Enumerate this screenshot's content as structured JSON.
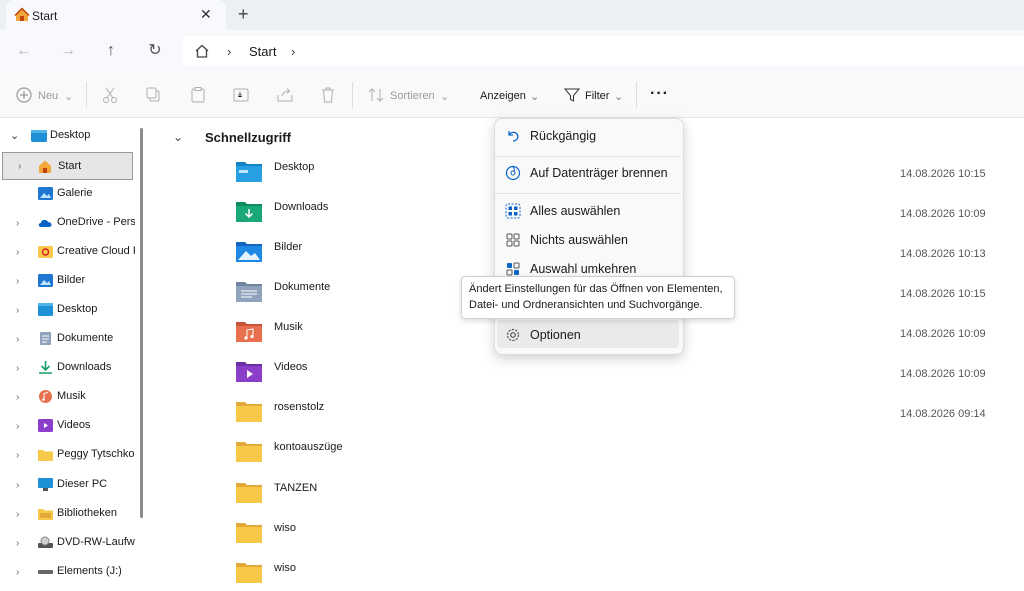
{
  "window": {
    "tab_title": "Start",
    "tab_close": "✕",
    "new_tab": "+"
  },
  "nav": {
    "breadcrumb": "Start",
    "sep1": "›",
    "sep2": "›"
  },
  "toolbar": {
    "new_label": "Neu",
    "sort_label": "Sortieren",
    "view_label": "Anzeigen",
    "filter_label": "Filter",
    "more_label": "···"
  },
  "sidebar": {
    "items": [
      {
        "label": "Desktop"
      },
      {
        "label": "Start"
      },
      {
        "label": "Galerie"
      },
      {
        "label": "OneDrive - Pers"
      },
      {
        "label": "Creative Cloud F"
      },
      {
        "label": "Bilder"
      },
      {
        "label": "Desktop"
      },
      {
        "label": "Dokumente"
      },
      {
        "label": "Downloads"
      },
      {
        "label": "Musik"
      },
      {
        "label": "Videos"
      },
      {
        "label": "Peggy Tytschko"
      },
      {
        "label": "Dieser PC"
      },
      {
        "label": "Bibliotheken"
      },
      {
        "label": "DVD-RW-Laufw"
      },
      {
        "label": "Elements (J:)"
      }
    ]
  },
  "main": {
    "section_title": "Schnellzugriff",
    "rows": [
      {
        "name": "Desktop",
        "date": "14.08.2026 10:15"
      },
      {
        "name": "Downloads",
        "date": "14.08.2026 10:09"
      },
      {
        "name": "Bilder",
        "date": "14.08.2026 10:13"
      },
      {
        "name": "Dokumente",
        "date": "14.08.2026 10:15"
      },
      {
        "name": "Musik",
        "date": "14.08.2026 10:09"
      },
      {
        "name": "Videos",
        "date": "14.08.2026 10:09"
      },
      {
        "name": "rosenstolz",
        "date": "14.08.2026 09:14"
      },
      {
        "name": "kontoauszüge",
        "date": ""
      },
      {
        "name": "TANZEN",
        "date": ""
      },
      {
        "name": "wiso",
        "date": ""
      },
      {
        "name": "wiso",
        "date": ""
      }
    ]
  },
  "menu": {
    "undo": "Rückgängig",
    "burn": "Auf Datenträger brennen",
    "select_all": "Alles auswählen",
    "select_none": "Nichts auswählen",
    "invert": "Auswahl umkehren",
    "options": "Optionen"
  },
  "tooltip": {
    "line1": "Ändert Einstellungen für das Öffnen von Elementen,",
    "line2": "Datei- und Ordneransichten und Suchvorgänge."
  },
  "colors": {
    "accent": "#0a64c8",
    "folder_yellow": "#f7c948"
  }
}
